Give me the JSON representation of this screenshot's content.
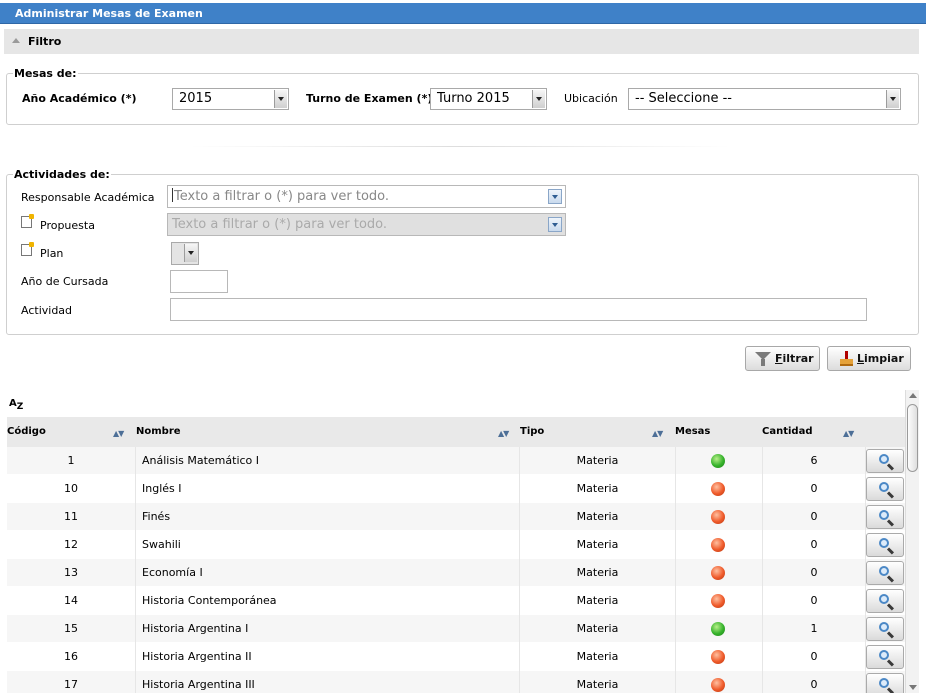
{
  "window": {
    "title": "Administrar Mesas de Examen"
  },
  "filter_panel": {
    "label": "Filtro"
  },
  "mesas": {
    "legend": "Mesas de:",
    "anio_label": "Año Académico (*)",
    "anio_value": "2015",
    "turno_label": "Turno de Examen (*)",
    "turno_value": "Turno 2015",
    "ubicacion_label": "Ubicación",
    "ubicacion_value": "-- Seleccione --"
  },
  "actividades": {
    "legend": "Actividades de:",
    "responsable_label": "Responsable Académica",
    "responsable_placeholder": "Texto a filtrar o (*) para ver todo.",
    "propuesta_label": "Propuesta",
    "propuesta_placeholder": "Texto a filtrar o (*) para ver todo.",
    "plan_label": "Plan",
    "anio_cursada_label": "Año de Cursada",
    "actividad_label": "Actividad"
  },
  "buttons": {
    "filtrar_key": "F",
    "filtrar_rest": "iltrar",
    "limpiar_key": "L",
    "limpiar_rest": "impiar"
  },
  "sort_icon": {
    "main": "A",
    "sub": "Z"
  },
  "table": {
    "headers": {
      "codigo": "Código",
      "nombre": "Nombre",
      "tipo": "Tipo",
      "mesas": "Mesas",
      "cantidad": "Cantidad"
    },
    "sort_arrows": "▲▼",
    "rows": [
      {
        "codigo": "1",
        "nombre": "Análisis Matemático I",
        "tipo": "Materia",
        "mesas": "green",
        "cantidad": "6"
      },
      {
        "codigo": "10",
        "nombre": "Inglés I",
        "tipo": "Materia",
        "mesas": "red",
        "cantidad": "0"
      },
      {
        "codigo": "11",
        "nombre": "Finés",
        "tipo": "Materia",
        "mesas": "red",
        "cantidad": "0"
      },
      {
        "codigo": "12",
        "nombre": "Swahili",
        "tipo": "Materia",
        "mesas": "red",
        "cantidad": "0"
      },
      {
        "codigo": "13",
        "nombre": "Economía I",
        "tipo": "Materia",
        "mesas": "red",
        "cantidad": "0"
      },
      {
        "codigo": "14",
        "nombre": "Historia Contemporánea",
        "tipo": "Materia",
        "mesas": "red",
        "cantidad": "0"
      },
      {
        "codigo": "15",
        "nombre": "Historia Argentina I",
        "tipo": "Materia",
        "mesas": "green",
        "cantidad": "1"
      },
      {
        "codigo": "16",
        "nombre": "Historia Argentina II",
        "tipo": "Materia",
        "mesas": "red",
        "cantidad": "0"
      },
      {
        "codigo": "17",
        "nombre": "Historia Argentina III",
        "tipo": "Materia",
        "mesas": "red",
        "cantidad": "0"
      }
    ]
  }
}
